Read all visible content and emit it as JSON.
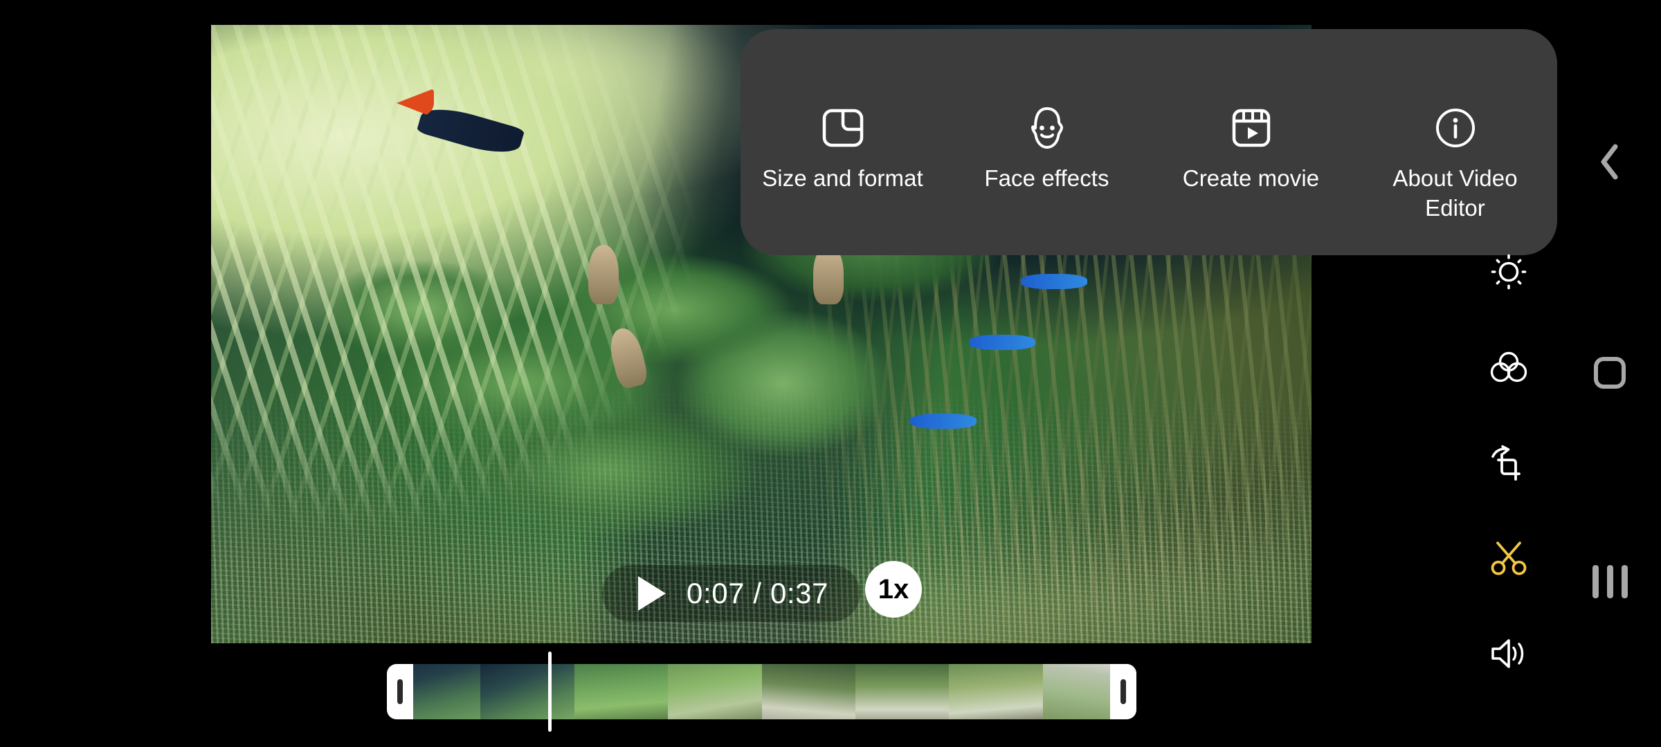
{
  "app": {
    "name": "Video Editor"
  },
  "video": {
    "current_time": "0:07",
    "total_time": "0:37",
    "time_readout": "0:07 / 0:37",
    "speed_label": "1x",
    "play_state": "paused"
  },
  "options_popup": {
    "items": [
      {
        "label": "Size and format",
        "icon": "size-and-format-icon"
      },
      {
        "label": "Face effects",
        "icon": "face-effects-icon"
      },
      {
        "label": "Create movie",
        "icon": "create-movie-icon"
      },
      {
        "label": "About Video Editor",
        "icon": "info-icon"
      }
    ],
    "background_color": "#3c3c3c"
  },
  "tool_rail": {
    "items": [
      {
        "name": "brightness",
        "icon": "brightness-icon",
        "color": "#ffffff",
        "active": false
      },
      {
        "name": "color-filter",
        "icon": "color-filter-icon",
        "color": "#ffffff",
        "active": false
      },
      {
        "name": "crop-rotate",
        "icon": "crop-rotate-icon",
        "color": "#ffffff",
        "active": false
      },
      {
        "name": "trim",
        "icon": "scissors-icon",
        "color": "#f2c744",
        "active": true
      },
      {
        "name": "volume",
        "icon": "volume-icon",
        "color": "#ffffff",
        "active": false
      }
    ],
    "accent_color": "#f2c744"
  },
  "navigation": {
    "back": "back-chevron-icon",
    "home": "home-icon",
    "recents": "recents-icon",
    "color": "#a8a8a8"
  },
  "timeline": {
    "thumbnail_count": 8,
    "playhead_position_pct": 21.5,
    "trim_left_label": "trim-start-handle",
    "trim_right_label": "trim-end-handle"
  }
}
